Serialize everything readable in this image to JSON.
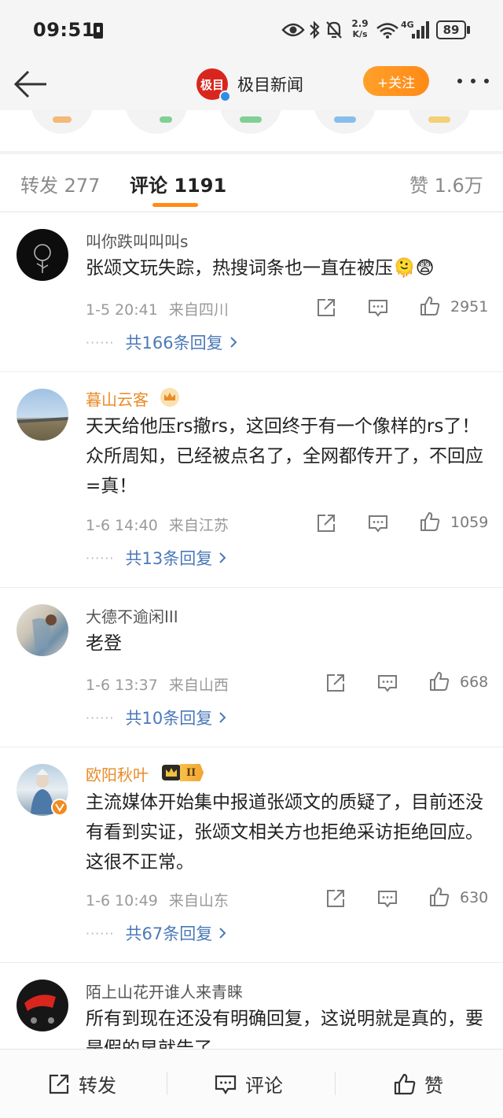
{
  "status_bar": {
    "time": "09:51",
    "net_speed_value": "2.9",
    "net_speed_unit": "K/s",
    "network_type": "4G",
    "battery": "89"
  },
  "nav": {
    "account_name": "极目新闻",
    "logo_text": "极目",
    "follow_label": "+关注"
  },
  "tabs": {
    "repost": "转发 277",
    "comment": "评论 1191",
    "likes": "赞 1.6万"
  },
  "comments": [
    {
      "user": "叫你跌叫叫叫s",
      "text": "张颂文玩失踪，热搜词条也一直在被压🫠😨",
      "time": "1-5 20:41",
      "location": "来自四川",
      "likes": "2951",
      "replies": "共166条回复"
    },
    {
      "user": "暮山云客",
      "text": "天天给他压rs撤rs，这回终于有一个像样的rs了！众所周知，已经被点名了，全网都传开了，不回应=真！",
      "time": "1-6 14:40",
      "location": "来自江苏",
      "likes": "1059",
      "replies": "共13条回复"
    },
    {
      "user": "大德不逾闲III",
      "text": "老登",
      "time": "1-6 13:37",
      "location": "来自山西",
      "likes": "668",
      "replies": "共10条回复"
    },
    {
      "user": "欧阳秋叶",
      "badge": "II",
      "text": "主流媒体开始集中报道张颂文的质疑了，目前还没有看到实证，张颂文相关方也拒绝采访拒绝回应。这很不正常。",
      "time": "1-6 10:49",
      "location": "来自山东",
      "likes": "630",
      "replies": "共67条回复"
    },
    {
      "user": "陌上山花开谁人来青睐",
      "text": "所有到现在还没有明确回复，这说明就是真的，要是假的早就告了"
    }
  ],
  "bottom_bar": {
    "repost": "转发",
    "comment": "评论",
    "like": "赞"
  },
  "colors": {
    "accent_orange": "#ff8a16",
    "link_blue": "#4a79b8",
    "vip_name": "#e98b28",
    "logo_red": "#d8261f"
  }
}
